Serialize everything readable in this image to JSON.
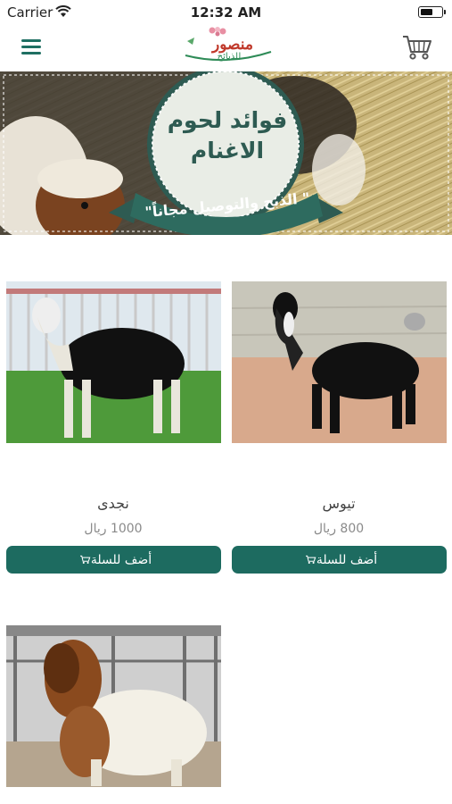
{
  "status_bar": {
    "carrier": "Carrier",
    "time": "12:32 AM",
    "battery_level": 0.6
  },
  "header": {
    "menu_icon": "hamburger-menu-icon",
    "logo_text": "منصور",
    "logo_subtext": "للذبائح",
    "cart_icon": "shopping-cart-icon"
  },
  "banner": {
    "title": "فوائد لحوم الاغنام",
    "ribbon_text": "\" الذبح والتوصيل مجاناً\""
  },
  "products": [
    {
      "name": "نجدى",
      "price": "1000 ريال",
      "button_label": "أضف للسلة"
    },
    {
      "name": "تيوس",
      "price": "800 ريال",
      "button_label": "أضف للسلة"
    },
    {
      "name": "",
      "price": "",
      "button_label": ""
    }
  ],
  "colors": {
    "accent": "#1d6b60",
    "logo_red": "#c0392b",
    "banner_text": "#2e5b52"
  }
}
